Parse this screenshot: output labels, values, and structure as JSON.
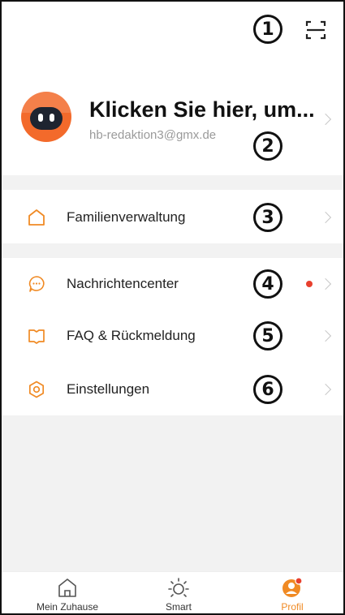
{
  "annotations": [
    "1",
    "2",
    "3",
    "4",
    "5",
    "6"
  ],
  "top": {
    "scan_icon": "scan-icon"
  },
  "profile": {
    "name": "Klicken Sie hier, um...",
    "email": "hb-redaktion3@gmx.de"
  },
  "menu": {
    "family": {
      "label": "Familienverwaltung",
      "icon": "home-icon"
    },
    "messages": {
      "label": "Nachrichtencenter",
      "icon": "message-icon",
      "has_unread_dot": true
    },
    "faq": {
      "label": "FAQ & Rückmeldung",
      "icon": "book-icon"
    },
    "settings": {
      "label": "Einstellungen",
      "icon": "settings-icon"
    }
  },
  "bottom_nav": {
    "items": [
      {
        "label": "Mein Zuhause",
        "icon": "home-icon",
        "active": false
      },
      {
        "label": "Smart",
        "icon": "sun-icon",
        "active": false
      },
      {
        "label": "Profil",
        "icon": "profile-icon",
        "active": true
      }
    ]
  },
  "colors": {
    "accent": "#f08a24",
    "notification": "#e8402e",
    "divider": "#f2f2f2",
    "secondary_text": "#9a9a9a"
  }
}
